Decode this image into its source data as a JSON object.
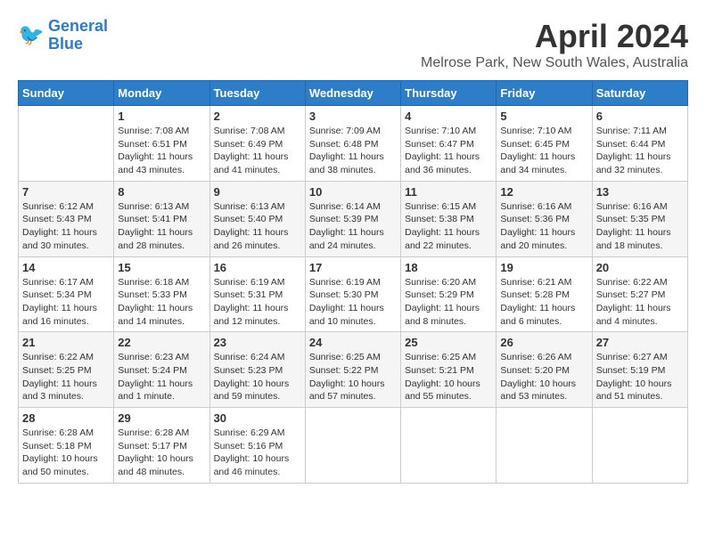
{
  "header": {
    "logo_line1": "General",
    "logo_line2": "Blue",
    "month_year": "April 2024",
    "location": "Melrose Park, New South Wales, Australia"
  },
  "days_of_week": [
    "Sunday",
    "Monday",
    "Tuesday",
    "Wednesday",
    "Thursday",
    "Friday",
    "Saturday"
  ],
  "weeks": [
    [
      {
        "day": "",
        "text": ""
      },
      {
        "day": "1",
        "text": "Sunrise: 7:08 AM\nSunset: 6:51 PM\nDaylight: 11 hours\nand 43 minutes."
      },
      {
        "day": "2",
        "text": "Sunrise: 7:08 AM\nSunset: 6:49 PM\nDaylight: 11 hours\nand 41 minutes."
      },
      {
        "day": "3",
        "text": "Sunrise: 7:09 AM\nSunset: 6:48 PM\nDaylight: 11 hours\nand 38 minutes."
      },
      {
        "day": "4",
        "text": "Sunrise: 7:10 AM\nSunset: 6:47 PM\nDaylight: 11 hours\nand 36 minutes."
      },
      {
        "day": "5",
        "text": "Sunrise: 7:10 AM\nSunset: 6:45 PM\nDaylight: 11 hours\nand 34 minutes."
      },
      {
        "day": "6",
        "text": "Sunrise: 7:11 AM\nSunset: 6:44 PM\nDaylight: 11 hours\nand 32 minutes."
      }
    ],
    [
      {
        "day": "7",
        "text": "Sunrise: 6:12 AM\nSunset: 5:43 PM\nDaylight: 11 hours\nand 30 minutes."
      },
      {
        "day": "8",
        "text": "Sunrise: 6:13 AM\nSunset: 5:41 PM\nDaylight: 11 hours\nand 28 minutes."
      },
      {
        "day": "9",
        "text": "Sunrise: 6:13 AM\nSunset: 5:40 PM\nDaylight: 11 hours\nand 26 minutes."
      },
      {
        "day": "10",
        "text": "Sunrise: 6:14 AM\nSunset: 5:39 PM\nDaylight: 11 hours\nand 24 minutes."
      },
      {
        "day": "11",
        "text": "Sunrise: 6:15 AM\nSunset: 5:38 PM\nDaylight: 11 hours\nand 22 minutes."
      },
      {
        "day": "12",
        "text": "Sunrise: 6:16 AM\nSunset: 5:36 PM\nDaylight: 11 hours\nand 20 minutes."
      },
      {
        "day": "13",
        "text": "Sunrise: 6:16 AM\nSunset: 5:35 PM\nDaylight: 11 hours\nand 18 minutes."
      }
    ],
    [
      {
        "day": "14",
        "text": "Sunrise: 6:17 AM\nSunset: 5:34 PM\nDaylight: 11 hours\nand 16 minutes."
      },
      {
        "day": "15",
        "text": "Sunrise: 6:18 AM\nSunset: 5:33 PM\nDaylight: 11 hours\nand 14 minutes."
      },
      {
        "day": "16",
        "text": "Sunrise: 6:19 AM\nSunset: 5:31 PM\nDaylight: 11 hours\nand 12 minutes."
      },
      {
        "day": "17",
        "text": "Sunrise: 6:19 AM\nSunset: 5:30 PM\nDaylight: 11 hours\nand 10 minutes."
      },
      {
        "day": "18",
        "text": "Sunrise: 6:20 AM\nSunset: 5:29 PM\nDaylight: 11 hours\nand 8 minutes."
      },
      {
        "day": "19",
        "text": "Sunrise: 6:21 AM\nSunset: 5:28 PM\nDaylight: 11 hours\nand 6 minutes."
      },
      {
        "day": "20",
        "text": "Sunrise: 6:22 AM\nSunset: 5:27 PM\nDaylight: 11 hours\nand 4 minutes."
      }
    ],
    [
      {
        "day": "21",
        "text": "Sunrise: 6:22 AM\nSunset: 5:25 PM\nDaylight: 11 hours\nand 3 minutes."
      },
      {
        "day": "22",
        "text": "Sunrise: 6:23 AM\nSunset: 5:24 PM\nDaylight: 11 hours\nand 1 minute."
      },
      {
        "day": "23",
        "text": "Sunrise: 6:24 AM\nSunset: 5:23 PM\nDaylight: 10 hours\nand 59 minutes."
      },
      {
        "day": "24",
        "text": "Sunrise: 6:25 AM\nSunset: 5:22 PM\nDaylight: 10 hours\nand 57 minutes."
      },
      {
        "day": "25",
        "text": "Sunrise: 6:25 AM\nSunset: 5:21 PM\nDaylight: 10 hours\nand 55 minutes."
      },
      {
        "day": "26",
        "text": "Sunrise: 6:26 AM\nSunset: 5:20 PM\nDaylight: 10 hours\nand 53 minutes."
      },
      {
        "day": "27",
        "text": "Sunrise: 6:27 AM\nSunset: 5:19 PM\nDaylight: 10 hours\nand 51 minutes."
      }
    ],
    [
      {
        "day": "28",
        "text": "Sunrise: 6:28 AM\nSunset: 5:18 PM\nDaylight: 10 hours\nand 50 minutes."
      },
      {
        "day": "29",
        "text": "Sunrise: 6:28 AM\nSunset: 5:17 PM\nDaylight: 10 hours\nand 48 minutes."
      },
      {
        "day": "30",
        "text": "Sunrise: 6:29 AM\nSunset: 5:16 PM\nDaylight: 10 hours\nand 46 minutes."
      },
      {
        "day": "",
        "text": ""
      },
      {
        "day": "",
        "text": ""
      },
      {
        "day": "",
        "text": ""
      },
      {
        "day": "",
        "text": ""
      }
    ]
  ]
}
